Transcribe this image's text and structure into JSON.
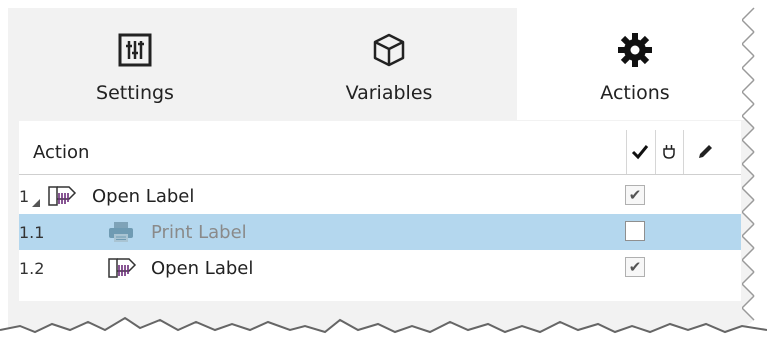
{
  "tabs": [
    {
      "label": "Settings",
      "icon": "settings-sliders-icon",
      "active": false
    },
    {
      "label": "Variables",
      "icon": "cube-icon",
      "active": false
    },
    {
      "label": "Actions",
      "icon": "gear-icon",
      "active": true
    }
  ],
  "grid": {
    "header": {
      "action_label": "Action",
      "col_enabled_icon": "checkmark-icon",
      "col_plugin_icon": "plug-icon",
      "col_edit_icon": "pencil-icon"
    },
    "rows": [
      {
        "number": "1",
        "label": "Open Label",
        "icon": "label-icon",
        "enabled": true,
        "expanded": true,
        "selected": false,
        "disabled": false
      },
      {
        "number": "1.1",
        "label": "Print Label",
        "icon": "printer-icon",
        "enabled": false,
        "expanded": null,
        "selected": true,
        "disabled": true
      },
      {
        "number": "1.2",
        "label": "Open Label",
        "icon": "label-icon",
        "enabled": true,
        "expanded": null,
        "selected": false,
        "disabled": false
      }
    ]
  },
  "colors": {
    "panel_bg": "#f2f2f2",
    "selected_row": "#b4d7ee",
    "disabled_text": "#8a8a8a",
    "label_icon_purple": "#6b2c7a"
  }
}
